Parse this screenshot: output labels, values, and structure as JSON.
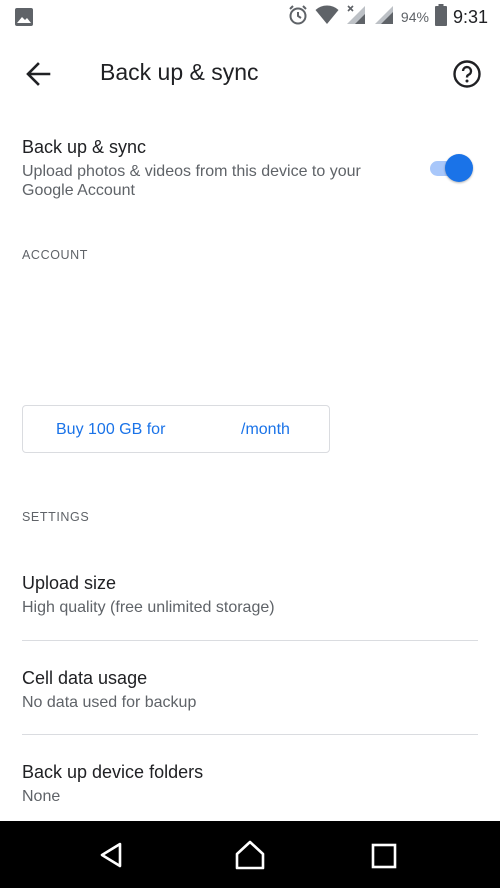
{
  "status_bar": {
    "battery_percent": "94%",
    "time": "9:31",
    "icons": [
      "gallery-icon",
      "alarm-icon",
      "wifi-icon",
      "cell-signal-no-data-icon",
      "cell-signal-icon",
      "battery-icon"
    ]
  },
  "app_bar": {
    "title": "Back up & sync",
    "back_icon": "arrow-back-icon",
    "help_icon": "help-icon"
  },
  "backup": {
    "title": "Back up & sync",
    "description": "Upload photos & videos from this device to your Google Account",
    "enabled": true
  },
  "account": {
    "header": "ACCOUNT",
    "buy_prefix": "Buy 100 GB for",
    "buy_suffix": "/month"
  },
  "settings": {
    "header": "SETTINGS",
    "items": [
      {
        "title": "Upload size",
        "subtitle": "High quality (free unlimited storage)"
      },
      {
        "title": "Cell data usage",
        "subtitle": "No data used for backup"
      },
      {
        "title": "Back up device folders",
        "subtitle": "None"
      }
    ]
  },
  "nav_bar": {
    "icons": [
      "nav-back-icon",
      "nav-home-icon",
      "nav-recents-icon"
    ]
  },
  "colors": {
    "accent": "#1a73e8",
    "toggle_track": "#a8c7fa",
    "text_primary": "#202124",
    "text_secondary": "#5f6368",
    "divider": "#dadce0"
  }
}
